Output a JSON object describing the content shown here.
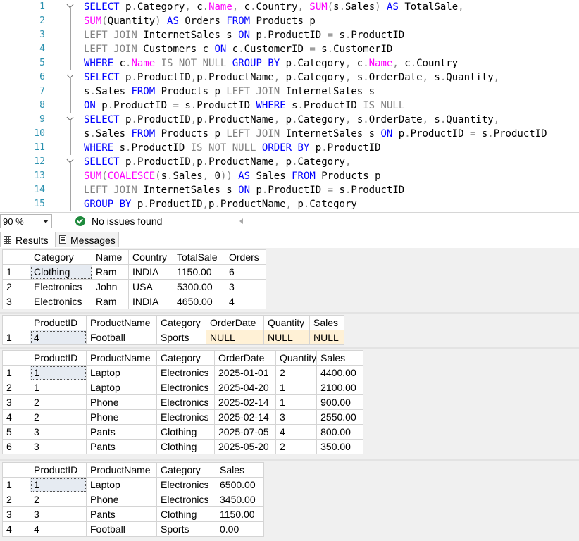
{
  "editor": {
    "lines": [
      {
        "n": "1",
        "fold": "start",
        "tokens": [
          [
            "k",
            "SELECT "
          ],
          [
            "b",
            "p"
          ],
          [
            "g",
            "."
          ],
          [
            "b",
            "Category"
          ],
          [
            "g",
            ", "
          ],
          [
            "b",
            "c"
          ],
          [
            "g",
            "."
          ],
          [
            "f",
            "Name"
          ],
          [
            "g",
            ", "
          ],
          [
            "b",
            "c"
          ],
          [
            "g",
            "."
          ],
          [
            "b",
            "Country"
          ],
          [
            "g",
            ", "
          ],
          [
            "f",
            "SUM"
          ],
          [
            "g",
            "("
          ],
          [
            "b",
            "s"
          ],
          [
            "g",
            "."
          ],
          [
            "b",
            "Sales"
          ],
          [
            "g",
            ") "
          ],
          [
            "k",
            "AS "
          ],
          [
            "b",
            "TotalSale"
          ],
          [
            "g",
            ","
          ]
        ]
      },
      {
        "n": "2",
        "fold": "bar",
        "tokens": [
          [
            "f",
            "SUM"
          ],
          [
            "g",
            "("
          ],
          [
            "b",
            "Quantity"
          ],
          [
            "g",
            ") "
          ],
          [
            "k",
            "AS "
          ],
          [
            "b",
            "Orders "
          ],
          [
            "k",
            "FROM "
          ],
          [
            "b",
            "Products p"
          ]
        ]
      },
      {
        "n": "3",
        "fold": "bar",
        "tokens": [
          [
            "g",
            "LEFT JOIN "
          ],
          [
            "b",
            "InternetSales s "
          ],
          [
            "k",
            "ON "
          ],
          [
            "b",
            "p"
          ],
          [
            "g",
            "."
          ],
          [
            "b",
            "ProductID "
          ],
          [
            "g",
            "= "
          ],
          [
            "b",
            "s"
          ],
          [
            "g",
            "."
          ],
          [
            "b",
            "ProductID"
          ]
        ]
      },
      {
        "n": "4",
        "fold": "bar",
        "tokens": [
          [
            "g",
            "LEFT JOIN "
          ],
          [
            "b",
            "Customers c "
          ],
          [
            "k",
            "ON "
          ],
          [
            "b",
            "c"
          ],
          [
            "g",
            "."
          ],
          [
            "b",
            "CustomerID "
          ],
          [
            "g",
            "= "
          ],
          [
            "b",
            "s"
          ],
          [
            "g",
            "."
          ],
          [
            "b",
            "CustomerID"
          ]
        ]
      },
      {
        "n": "5",
        "fold": "bar",
        "tokens": [
          [
            "k",
            "WHERE "
          ],
          [
            "b",
            "c"
          ],
          [
            "g",
            "."
          ],
          [
            "f",
            "Name "
          ],
          [
            "g",
            "IS NOT NULL "
          ],
          [
            "k",
            "GROUP BY "
          ],
          [
            "b",
            "p"
          ],
          [
            "g",
            "."
          ],
          [
            "b",
            "Category"
          ],
          [
            "g",
            ", "
          ],
          [
            "b",
            "c"
          ],
          [
            "g",
            "."
          ],
          [
            "f",
            "Name"
          ],
          [
            "g",
            ", "
          ],
          [
            "b",
            "c"
          ],
          [
            "g",
            "."
          ],
          [
            "b",
            "Country"
          ]
        ]
      },
      {
        "n": "6",
        "fold": "start",
        "tokens": [
          [
            "k",
            "SELECT "
          ],
          [
            "b",
            "p"
          ],
          [
            "g",
            "."
          ],
          [
            "b",
            "ProductID"
          ],
          [
            "g",
            ","
          ],
          [
            "b",
            "p"
          ],
          [
            "g",
            "."
          ],
          [
            "b",
            "ProductName"
          ],
          [
            "g",
            ", "
          ],
          [
            "b",
            "p"
          ],
          [
            "g",
            "."
          ],
          [
            "b",
            "Category"
          ],
          [
            "g",
            ", "
          ],
          [
            "b",
            "s"
          ],
          [
            "g",
            "."
          ],
          [
            "b",
            "OrderDate"
          ],
          [
            "g",
            ", "
          ],
          [
            "b",
            "s"
          ],
          [
            "g",
            "."
          ],
          [
            "b",
            "Quantity"
          ],
          [
            "g",
            ","
          ]
        ]
      },
      {
        "n": "7",
        "fold": "bar",
        "tokens": [
          [
            "b",
            "s"
          ],
          [
            "g",
            "."
          ],
          [
            "b",
            "Sales "
          ],
          [
            "k",
            "FROM "
          ],
          [
            "b",
            "Products p "
          ],
          [
            "g",
            "LEFT JOIN "
          ],
          [
            "b",
            "InternetSales s"
          ]
        ]
      },
      {
        "n": "8",
        "fold": "bar",
        "tokens": [
          [
            "k",
            "ON "
          ],
          [
            "b",
            "p"
          ],
          [
            "g",
            "."
          ],
          [
            "b",
            "ProductID "
          ],
          [
            "g",
            "= "
          ],
          [
            "b",
            "s"
          ],
          [
            "g",
            "."
          ],
          [
            "b",
            "ProductID "
          ],
          [
            "k",
            "WHERE "
          ],
          [
            "b",
            "s"
          ],
          [
            "g",
            "."
          ],
          [
            "b",
            "ProductID "
          ],
          [
            "g",
            "IS NULL"
          ]
        ]
      },
      {
        "n": "9",
        "fold": "start",
        "tokens": [
          [
            "k",
            "SELECT "
          ],
          [
            "b",
            "p"
          ],
          [
            "g",
            "."
          ],
          [
            "b",
            "ProductID"
          ],
          [
            "g",
            ","
          ],
          [
            "b",
            "p"
          ],
          [
            "g",
            "."
          ],
          [
            "b",
            "ProductName"
          ],
          [
            "g",
            ", "
          ],
          [
            "b",
            "p"
          ],
          [
            "g",
            "."
          ],
          [
            "b",
            "Category"
          ],
          [
            "g",
            ", "
          ],
          [
            "b",
            "s"
          ],
          [
            "g",
            "."
          ],
          [
            "b",
            "OrderDate"
          ],
          [
            "g",
            ", "
          ],
          [
            "b",
            "s"
          ],
          [
            "g",
            "."
          ],
          [
            "b",
            "Quantity"
          ],
          [
            "g",
            ","
          ]
        ]
      },
      {
        "n": "10",
        "fold": "bar",
        "tokens": [
          [
            "b",
            "s"
          ],
          [
            "g",
            "."
          ],
          [
            "b",
            "Sales "
          ],
          [
            "k",
            "FROM "
          ],
          [
            "b",
            "Products p "
          ],
          [
            "g",
            "LEFT JOIN "
          ],
          [
            "b",
            "InternetSales s "
          ],
          [
            "k",
            "ON "
          ],
          [
            "b",
            "p"
          ],
          [
            "g",
            "."
          ],
          [
            "b",
            "ProductID "
          ],
          [
            "g",
            "= "
          ],
          [
            "b",
            "s"
          ],
          [
            "g",
            "."
          ],
          [
            "b",
            "ProductID"
          ]
        ]
      },
      {
        "n": "11",
        "fold": "bar",
        "tokens": [
          [
            "k",
            "WHERE "
          ],
          [
            "b",
            "s"
          ],
          [
            "g",
            "."
          ],
          [
            "b",
            "ProductID "
          ],
          [
            "g",
            "IS NOT NULL "
          ],
          [
            "k",
            "ORDER BY "
          ],
          [
            "b",
            "p"
          ],
          [
            "g",
            "."
          ],
          [
            "b",
            "ProductID"
          ]
        ]
      },
      {
        "n": "12",
        "fold": "start",
        "tokens": [
          [
            "k",
            "SELECT "
          ],
          [
            "b",
            "p"
          ],
          [
            "g",
            "."
          ],
          [
            "b",
            "ProductID"
          ],
          [
            "g",
            ","
          ],
          [
            "b",
            "p"
          ],
          [
            "g",
            "."
          ],
          [
            "b",
            "ProductName"
          ],
          [
            "g",
            ", "
          ],
          [
            "b",
            "p"
          ],
          [
            "g",
            "."
          ],
          [
            "b",
            "Category"
          ],
          [
            "g",
            ","
          ]
        ]
      },
      {
        "n": "13",
        "fold": "bar",
        "tokens": [
          [
            "f",
            "SUM"
          ],
          [
            "g",
            "("
          ],
          [
            "f",
            "COALESCE"
          ],
          [
            "g",
            "("
          ],
          [
            "b",
            "s"
          ],
          [
            "g",
            "."
          ],
          [
            "b",
            "Sales"
          ],
          [
            "g",
            ", "
          ],
          [
            "b",
            "0"
          ],
          [
            "g",
            "))"
          ],
          [
            "k",
            " AS "
          ],
          [
            "b",
            "Sales "
          ],
          [
            "k",
            "FROM "
          ],
          [
            "b",
            "Products p"
          ]
        ]
      },
      {
        "n": "14",
        "fold": "bar",
        "tokens": [
          [
            "g",
            "LEFT JOIN "
          ],
          [
            "b",
            "InternetSales s "
          ],
          [
            "k",
            "ON "
          ],
          [
            "b",
            "p"
          ],
          [
            "g",
            "."
          ],
          [
            "b",
            "ProductID "
          ],
          [
            "g",
            "= "
          ],
          [
            "b",
            "s"
          ],
          [
            "g",
            "."
          ],
          [
            "b",
            "ProductID"
          ]
        ]
      },
      {
        "n": "15",
        "fold": "bar",
        "tokens": [
          [
            "k",
            "GROUP BY "
          ],
          [
            "b",
            "p"
          ],
          [
            "g",
            "."
          ],
          [
            "b",
            "ProductID"
          ],
          [
            "g",
            ","
          ],
          [
            "b",
            "p"
          ],
          [
            "g",
            "."
          ],
          [
            "b",
            "ProductName"
          ],
          [
            "g",
            ", "
          ],
          [
            "b",
            "p"
          ],
          [
            "g",
            "."
          ],
          [
            "b",
            "Category"
          ]
        ]
      }
    ]
  },
  "status": {
    "zoom": "90 %",
    "issues": "No issues found"
  },
  "tabs": {
    "results": "Results",
    "messages": "Messages"
  },
  "grids": [
    {
      "headers": [
        "Category",
        "Name",
        "Country",
        "TotalSale",
        "Orders"
      ],
      "rows": [
        [
          "1",
          "Clothing",
          "Ram",
          "INDIA",
          "1150.00",
          "6"
        ],
        [
          "2",
          "Electronics",
          "John",
          "USA",
          "5300.00",
          "3"
        ],
        [
          "3",
          "Electronics",
          "Ram",
          "INDIA",
          "4650.00",
          "4"
        ]
      ]
    },
    {
      "headers": [
        "ProductID",
        "ProductName",
        "Category",
        "OrderDate",
        "Quantity",
        "Sales"
      ],
      "rows": [
        [
          "1",
          "4",
          "Football",
          "Sports",
          "NULL",
          "NULL",
          "NULL"
        ]
      ]
    },
    {
      "headers": [
        "ProductID",
        "ProductName",
        "Category",
        "OrderDate",
        "Quantity",
        "Sales"
      ],
      "rows": [
        [
          "1",
          "1",
          "Laptop",
          "Electronics",
          "2025-01-01",
          "2",
          "4400.00"
        ],
        [
          "2",
          "1",
          "Laptop",
          "Electronics",
          "2025-04-20",
          "1",
          "2100.00"
        ],
        [
          "3",
          "2",
          "Phone",
          "Electronics",
          "2025-02-14",
          "1",
          "900.00"
        ],
        [
          "4",
          "2",
          "Phone",
          "Electronics",
          "2025-02-14",
          "3",
          "2550.00"
        ],
        [
          "5",
          "3",
          "Pants",
          "Clothing",
          "2025-07-05",
          "4",
          "800.00"
        ],
        [
          "6",
          "3",
          "Pants",
          "Clothing",
          "2025-05-20",
          "2",
          "350.00"
        ]
      ]
    },
    {
      "headers": [
        "ProductID",
        "ProductName",
        "Category",
        "Sales"
      ],
      "rows": [
        [
          "1",
          "1",
          "Laptop",
          "Electronics",
          "6500.00"
        ],
        [
          "2",
          "2",
          "Phone",
          "Electronics",
          "3450.00"
        ],
        [
          "3",
          "3",
          "Pants",
          "Clothing",
          "1150.00"
        ],
        [
          "4",
          "4",
          "Football",
          "Sports",
          "0.00"
        ]
      ]
    }
  ]
}
